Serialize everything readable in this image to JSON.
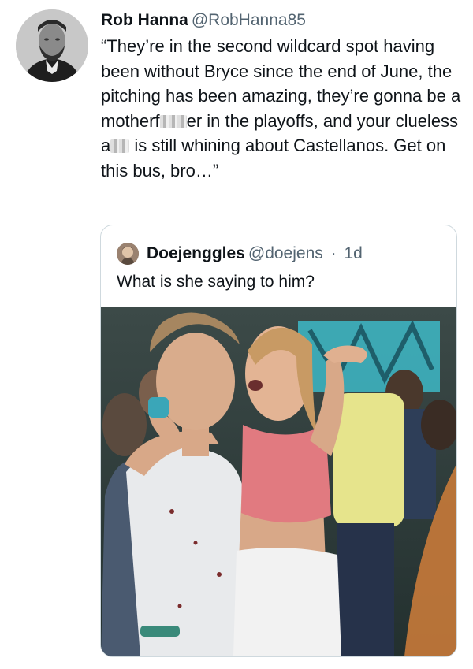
{
  "tweet": {
    "author_name": "Rob Hanna",
    "author_handle": "@RobHanna85",
    "text_part1": "“They’re in the second wildcard spot having been without Bryce since the end of June, the pitching has been amazing, they’re gonna be a motherf",
    "text_part2": "er in the playoffs, and your clueless a",
    "text_part3": " is still whining about Castellanos. Get on this bus, bro…”"
  },
  "quoted_tweet": {
    "author_name": "Doejenggles",
    "author_handle": "@doejens",
    "separator": "·",
    "time": "1d",
    "text": "What is she saying to him?"
  },
  "colors": {
    "text": "#0f1419",
    "secondary": "#536471",
    "border": "#cfd9de"
  }
}
